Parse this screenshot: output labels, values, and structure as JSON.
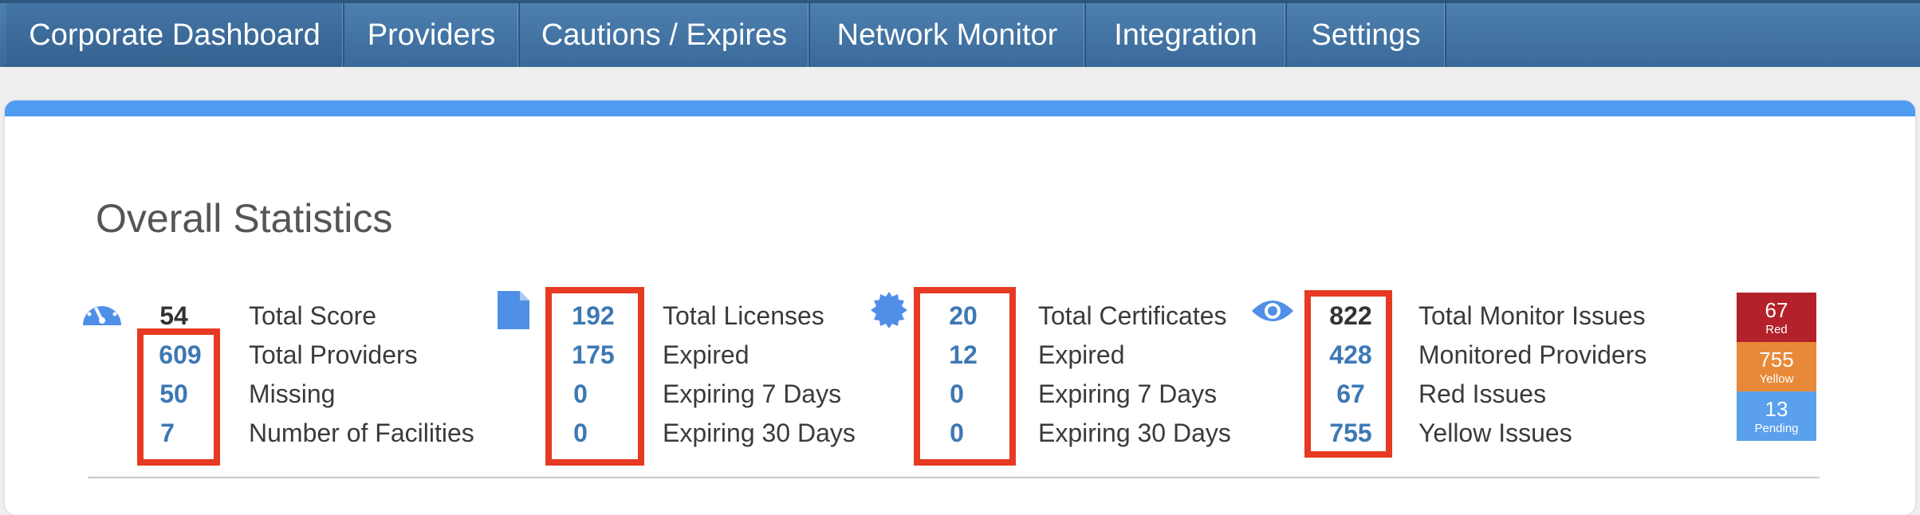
{
  "nav": {
    "tabs": [
      {
        "label": "Corporate Dashboard"
      },
      {
        "label": "Providers"
      },
      {
        "label": "Cautions / Expires"
      },
      {
        "label": "Network Monitor"
      },
      {
        "label": "Integration"
      },
      {
        "label": "Settings"
      }
    ]
  },
  "page": {
    "title": "Overall Statistics"
  },
  "colors": {
    "nav": "#3a6a99",
    "panel_accent": "#4f9bf2",
    "link": "#3d78b4",
    "highlight": "#e63a22",
    "red": "#b3222a",
    "yellow": "#e8893a",
    "pending": "#5aa0ec"
  },
  "icons": {
    "score": "speedometer-icon",
    "licenses": "document-icon",
    "certificates": "badge-icon",
    "monitor": "eye-icon"
  },
  "stats": {
    "providers": {
      "rows": [
        {
          "value": "54",
          "label": "Total Score"
        },
        {
          "value": "609",
          "label": "Total Providers"
        },
        {
          "value": "50",
          "label": "Missing"
        },
        {
          "value": "7",
          "label": "Number of Facilities"
        }
      ]
    },
    "licenses": {
      "rows": [
        {
          "value": "192",
          "label": "Total Licenses"
        },
        {
          "value": "175",
          "label": "Expired"
        },
        {
          "value": "0",
          "label": "Expiring 7 Days"
        },
        {
          "value": "0",
          "label": "Expiring 30 Days"
        }
      ]
    },
    "certificates": {
      "rows": [
        {
          "value": "20",
          "label": "Total Certificates"
        },
        {
          "value": "12",
          "label": "Expired"
        },
        {
          "value": "0",
          "label": "Expiring 7 Days"
        },
        {
          "value": "0",
          "label": "Expiring 30 Days"
        }
      ]
    },
    "monitor": {
      "rows": [
        {
          "value": "822",
          "label": "Total Monitor Issues"
        },
        {
          "value": "428",
          "label": "Monitored Providers"
        },
        {
          "value": "67",
          "label": "Red Issues"
        },
        {
          "value": "755",
          "label": "Yellow Issues"
        }
      ]
    }
  },
  "status_stack": [
    {
      "count": "67",
      "label": "Red"
    },
    {
      "count": "755",
      "label": "Yellow"
    },
    {
      "count": "13",
      "label": "Pending"
    }
  ]
}
